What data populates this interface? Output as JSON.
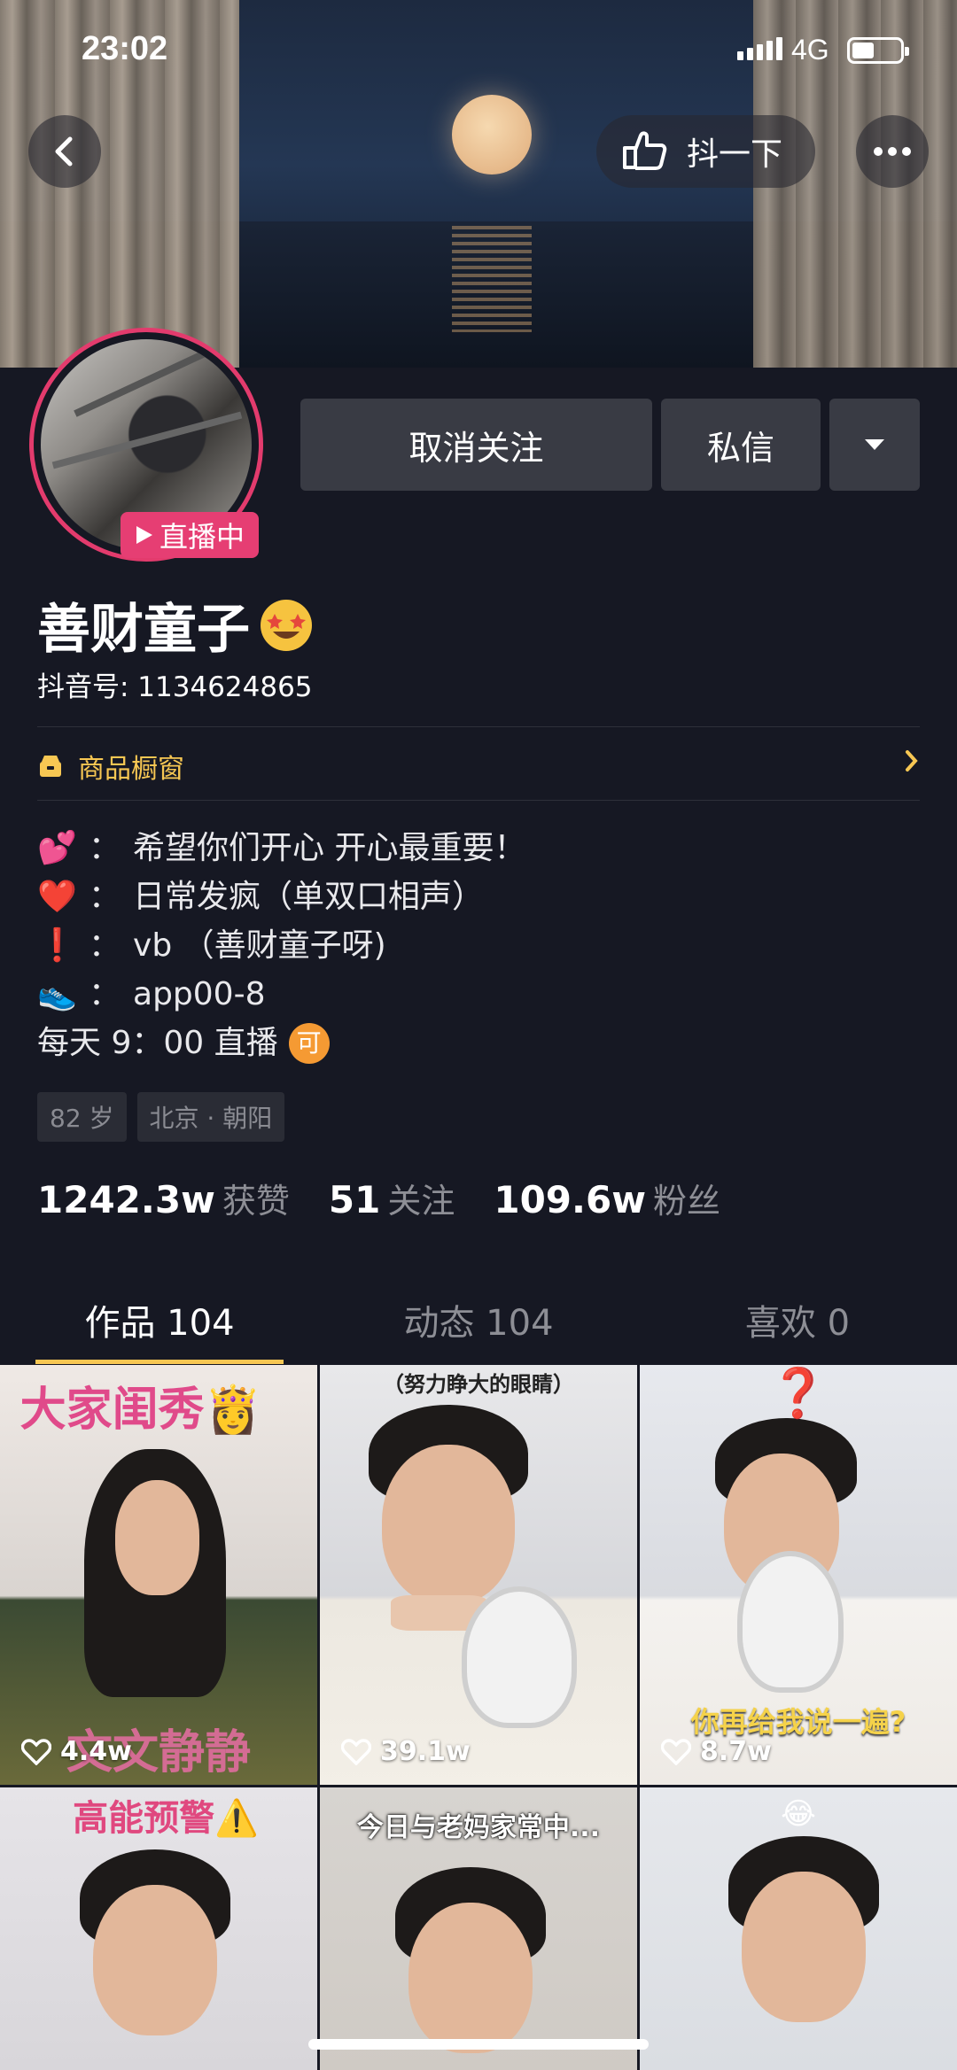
{
  "status_bar": {
    "time": "23:02",
    "network": "4G"
  },
  "header": {
    "shake_label": "抖一下",
    "back_icon": "chevron-left-icon",
    "more_icon": "more-dots-icon"
  },
  "profile": {
    "live_badge": "直播中",
    "buttons": {
      "unfollow": "取消关注",
      "message": "私信"
    },
    "nickname": "善财童子",
    "douyin_id": "抖音号: 1134624865",
    "shop_label": "商品橱窗",
    "bio": [
      {
        "emoji": "💕",
        "colon": "：",
        "text": "希望你们开心 开心最重要！"
      },
      {
        "emoji": "❤️",
        "colon": "：",
        "text": "日常发疯（单双口相声）"
      },
      {
        "emoji": "❗",
        "colon": "：",
        "text": "vb （善财童子呀)"
      },
      {
        "emoji": "👟",
        "colon": "：",
        "text": "app00-8"
      }
    ],
    "bio_last": "每天 9：00 直播",
    "bio_badge": "可",
    "tags": [
      "82 岁",
      "北京 · 朝阳"
    ],
    "stats": [
      {
        "value": "1242.3w",
        "label": "获赞"
      },
      {
        "value": "51",
        "label": "关注"
      },
      {
        "value": "109.6w",
        "label": "粉丝"
      }
    ]
  },
  "tabs": [
    {
      "label": "作品 104",
      "active": true
    },
    {
      "label": "动态 104",
      "active": false
    },
    {
      "label": "喜欢 0",
      "active": false
    }
  ],
  "videos": [
    {
      "top_caption": "大家闺秀👸",
      "bottom_caption": "文文静静",
      "likes": "4.4w"
    },
    {
      "top_caption": "（努力睁大的眼睛）",
      "bottom_caption": "",
      "likes": "39.1w"
    },
    {
      "top_caption": "❓",
      "bottom_caption": "你再给我说一遍?",
      "likes": "8.7w"
    },
    {
      "top_caption": "高能预警⚠️",
      "bottom_caption": "",
      "likes": ""
    },
    {
      "top_caption": "今日与老妈家常中...",
      "bottom_caption": "",
      "likes": ""
    },
    {
      "top_caption": "😂",
      "bottom_caption": "",
      "likes": ""
    }
  ],
  "colors": {
    "background": "#161823",
    "accent_yellow": "#f7c753",
    "live_pink": "#e63e73",
    "button_gray": "#393b44"
  }
}
